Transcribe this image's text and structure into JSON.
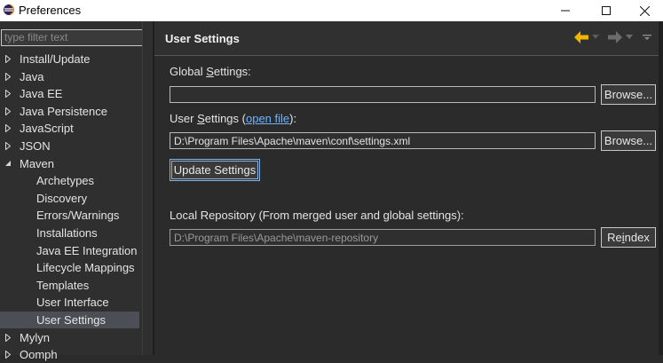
{
  "window": {
    "title": "Preferences",
    "minimize_glyph": "—",
    "maximize_glyph": "□",
    "close_glyph": "✕"
  },
  "sidebar": {
    "filter_placeholder": "type filter text",
    "items": [
      {
        "label": "Install/Update",
        "expanded": false,
        "level": 0
      },
      {
        "label": "Java",
        "expanded": false,
        "level": 0
      },
      {
        "label": "Java EE",
        "expanded": false,
        "level": 0
      },
      {
        "label": "Java Persistence",
        "expanded": false,
        "level": 0
      },
      {
        "label": "JavaScript",
        "expanded": false,
        "level": 0
      },
      {
        "label": "JSON",
        "expanded": false,
        "level": 0
      },
      {
        "label": "Maven",
        "expanded": true,
        "level": 0
      },
      {
        "label": "Archetypes",
        "level": 1
      },
      {
        "label": "Discovery",
        "level": 1
      },
      {
        "label": "Errors/Warnings",
        "level": 1
      },
      {
        "label": "Installations",
        "level": 1
      },
      {
        "label": "Java EE Integration",
        "level": 1
      },
      {
        "label": "Lifecycle Mappings",
        "level": 1
      },
      {
        "label": "Templates",
        "level": 1
      },
      {
        "label": "User Interface",
        "level": 1
      },
      {
        "label": "User Settings",
        "level": 1,
        "selected": true
      },
      {
        "label": "Mylyn",
        "expanded": false,
        "level": 0
      },
      {
        "label": "Oomph",
        "expanded": false,
        "level": 0
      }
    ]
  },
  "main": {
    "title": "User Settings",
    "global_settings": {
      "label_pre": "Global ",
      "label_accel": "S",
      "label_post": "ettings:",
      "value": "",
      "browse_label": "Browse..."
    },
    "user_settings": {
      "label_pre": "User ",
      "label_accel": "S",
      "label_post": "ettings (",
      "link": "open file",
      "label_end": "):",
      "value": "D:\\Program Files\\Apache\\maven\\conf\\settings.xml",
      "browse_label": "Browse..."
    },
    "update_button": "Update Settings",
    "local_repo": {
      "label": "Local Repository (From merged user and global settings):",
      "value": "D:\\Program Files\\Apache\\maven-repository",
      "reindex_pre": "Re",
      "reindex_accel": "i",
      "reindex_post": "ndex"
    }
  },
  "colors": {
    "back_arrow": "#f0b400",
    "forward_arrow": "#6c6c6c",
    "link": "#6fb3ff"
  }
}
